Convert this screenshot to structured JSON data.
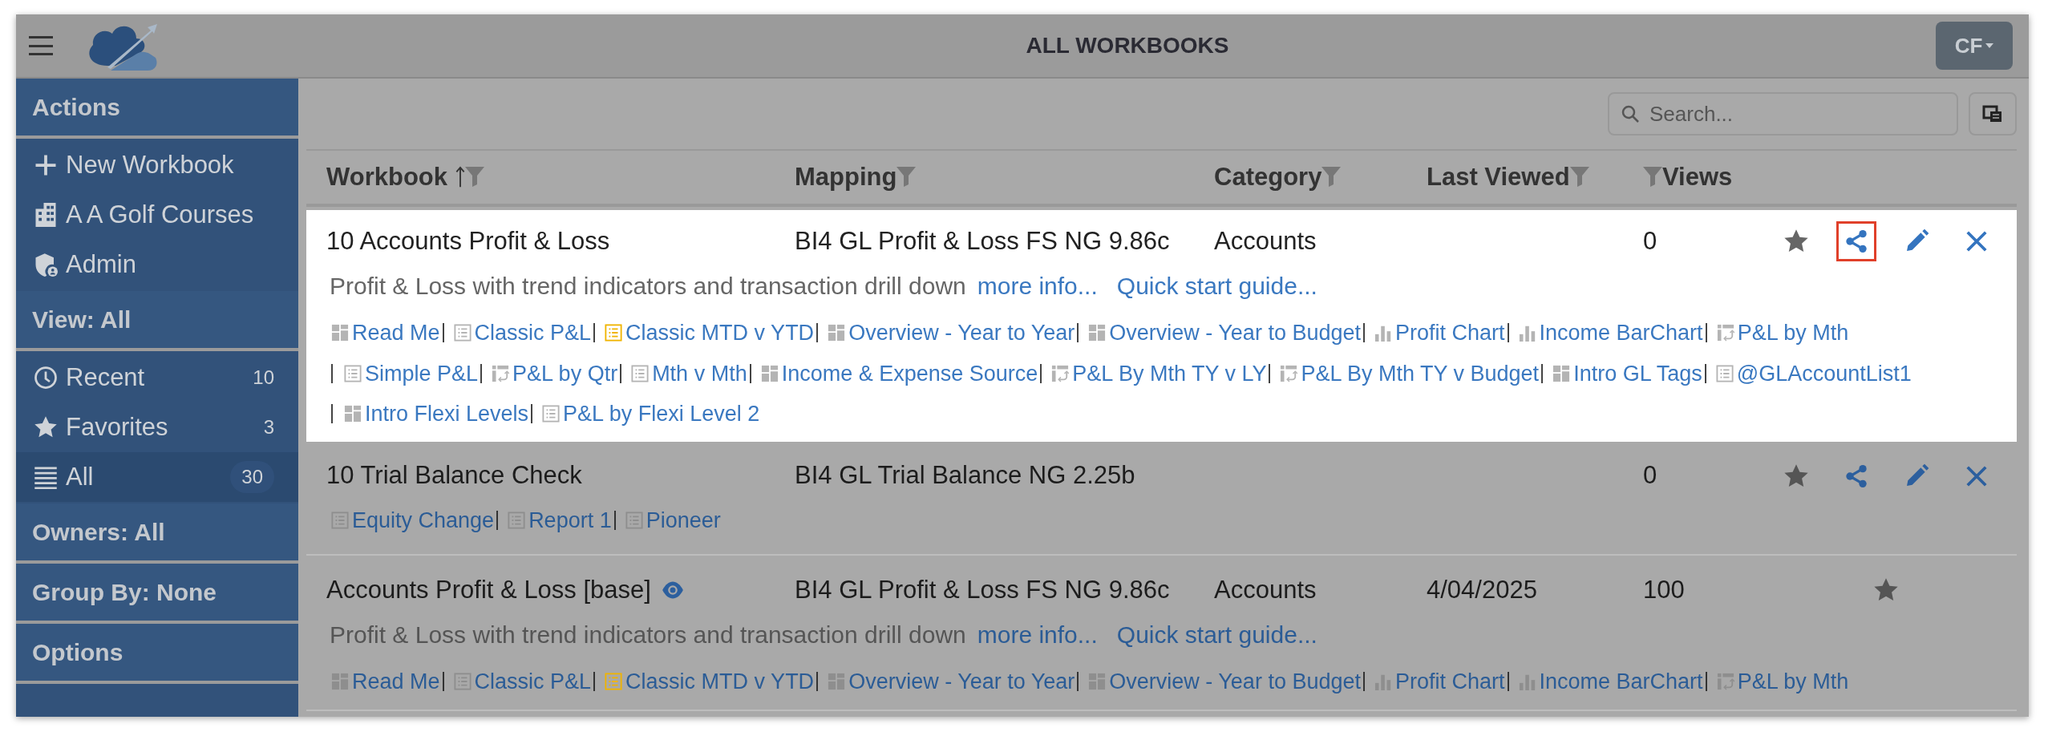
{
  "app": {
    "title": "ALL WORKBOOKS",
    "user_button": "CF"
  },
  "sidebar": {
    "sections": [
      {
        "heading": "Actions",
        "items": [
          {
            "kind": "plus",
            "label": "New Workbook"
          },
          {
            "kind": "building",
            "label": "A A Golf Courses"
          },
          {
            "kind": "shield",
            "label": "Admin"
          }
        ]
      },
      {
        "heading": "View: All",
        "items": [
          {
            "kind": "clock",
            "label": "Recent",
            "count": "10",
            "selected": false
          },
          {
            "kind": "star",
            "label": "Favorites",
            "count": "3",
            "selected": false
          },
          {
            "kind": "lines",
            "label": "All",
            "count": "30",
            "selected": true
          }
        ]
      },
      {
        "heading": "Owners: All"
      },
      {
        "heading": "Group By: None"
      },
      {
        "heading": "Options"
      }
    ]
  },
  "search": {
    "placeholder": "Search..."
  },
  "table": {
    "columns": [
      {
        "label": "Workbook",
        "kind": "sorted"
      },
      {
        "label": "Mapping",
        "kind": "filter"
      },
      {
        "label": "Category",
        "kind": "filter"
      },
      {
        "label": "Last Viewed",
        "kind": "filter"
      },
      {
        "label": "Views",
        "kind": "filter_left"
      }
    ],
    "rows": [
      {
        "highlighted": true,
        "workbook": "10 Accounts Profit & Loss",
        "watched": false,
        "mapping": "BI4 GL Profit & Loss FS NG 9.86c",
        "category": "Accounts",
        "views": "0",
        "description": "Profit & Loss with trend indicators and transaction drill down",
        "more_info": "more info...",
        "guide": "Quick start guide...",
        "link_lines": [
          [
            {
              "kind": "dashboard",
              "label": "Read Me",
              "highlighted": false
            },
            {
              "kind": "report",
              "label": "Classic P&L",
              "highlighted": false
            },
            {
              "kind": "report",
              "label": "Classic MTD v YTD",
              "highlighted": true
            },
            {
              "kind": "dashboard",
              "label": "Overview - Year to Year",
              "highlighted": false
            },
            {
              "kind": "dashboard",
              "label": "Overview - Year to Budget",
              "highlighted": false
            },
            {
              "kind": "chart",
              "label": "Profit Chart",
              "highlighted": false
            },
            {
              "kind": "chart",
              "label": "Income BarChart",
              "highlighted": false
            },
            {
              "kind": "pivot",
              "label": "P&L by Mth",
              "highlighted": false
            }
          ],
          [
            {
              "kind": "report",
              "label": "Simple P&L",
              "highlighted": false
            },
            {
              "kind": "pivot",
              "label": "P&L by Qtr",
              "highlighted": false
            },
            {
              "kind": "report",
              "label": "Mth v Mth",
              "highlighted": false
            },
            {
              "kind": "dashboard",
              "label": "Income & Expense Source",
              "highlighted": false
            },
            {
              "kind": "pivot",
              "label": "P&L By Mth TY v LY",
              "highlighted": false
            },
            {
              "kind": "pivot",
              "label": "P&L By Mth TY v Budget",
              "highlighted": false
            },
            {
              "kind": "dashboard",
              "label": "Intro GL Tags",
              "highlighted": false
            },
            {
              "kind": "report",
              "label": "@GLAccountList1",
              "highlighted": false
            }
          ],
          [
            {
              "kind": "dashboard",
              "label": "Intro Flexi Levels",
              "highlighted": false
            },
            {
              "kind": "report",
              "label": "P&L by Flexi Level 2",
              "highlighted": false
            }
          ]
        ],
        "actions": [
          {
            "kind": "favorite",
            "focused": false
          },
          {
            "kind": "share",
            "focused": true
          },
          {
            "kind": "edit",
            "focused": false
          },
          {
            "kind": "delete",
            "focused": false
          }
        ]
      },
      {
        "highlighted": false,
        "workbook": "10 Trial Balance Check",
        "watched": false,
        "mapping": "BI4 GL Trial Balance NG 2.25b",
        "views": "0",
        "link_lines": [
          [
            {
              "kind": "report",
              "label": "Equity Change",
              "highlighted": false
            },
            {
              "kind": "report",
              "label": "Report 1",
              "highlighted": false
            },
            {
              "kind": "report",
              "label": "Pioneer",
              "highlighted": false
            }
          ]
        ],
        "actions": [
          {
            "kind": "favorite",
            "focused": false
          },
          {
            "kind": "share",
            "focused": false
          },
          {
            "kind": "edit",
            "focused": false
          },
          {
            "kind": "delete",
            "focused": false
          }
        ]
      },
      {
        "highlighted": false,
        "workbook": "Accounts Profit & Loss [base]",
        "watched": true,
        "mapping": "BI4 GL Profit & Loss FS NG 9.86c",
        "category": "Accounts",
        "last_viewed": "4/04/2025",
        "views": "100",
        "description": "Profit & Loss with trend indicators and transaction drill down",
        "more_info": "more info...",
        "guide": "Quick start guide...",
        "link_lines": [
          [
            {
              "kind": "dashboard",
              "label": "Read Me",
              "highlighted": false
            },
            {
              "kind": "report",
              "label": "Classic P&L",
              "highlighted": false
            },
            {
              "kind": "report",
              "label": "Classic MTD v YTD",
              "highlighted": true
            },
            {
              "kind": "dashboard",
              "label": "Overview - Year to Year",
              "highlighted": false
            },
            {
              "kind": "dashboard",
              "label": "Overview - Year to Budget",
              "highlighted": false
            },
            {
              "kind": "chart",
              "label": "Profit Chart",
              "highlighted": false
            },
            {
              "kind": "chart",
              "label": "Income BarChart",
              "highlighted": false
            },
            {
              "kind": "pivot",
              "label": "P&L by Mth",
              "highlighted": false
            }
          ]
        ],
        "actions": [
          {
            "kind": "favorite",
            "focused": false
          }
        ]
      }
    ]
  }
}
